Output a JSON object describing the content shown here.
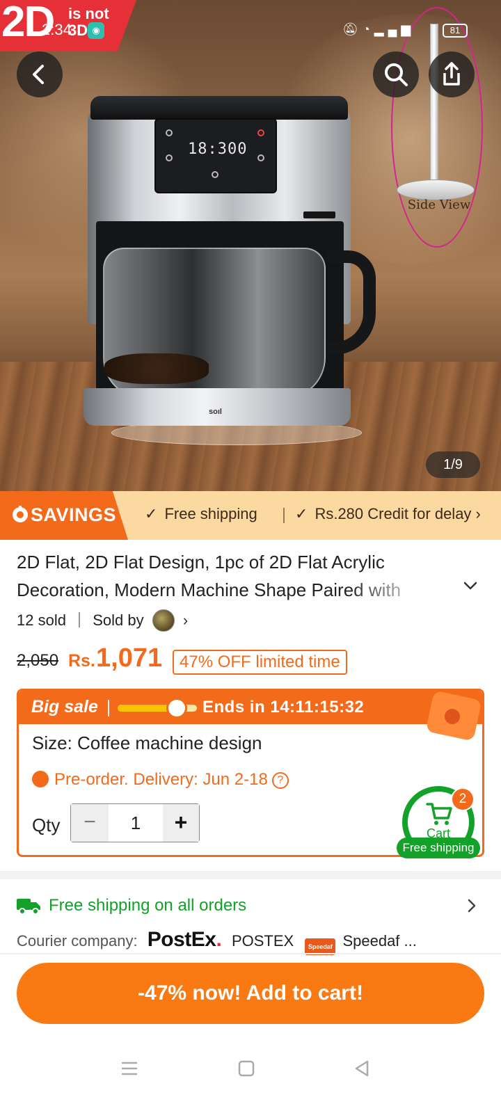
{
  "status_bar": {
    "time": "2:34",
    "battery": "81"
  },
  "hero": {
    "badge_big": "2D",
    "badge_small_1": "is not",
    "badge_small_2": "3D",
    "panel_time": "18:300",
    "base_brand": "soıl",
    "side_view_caption": "Side View",
    "image_counter": "1/9"
  },
  "savings": {
    "label": "SAVINGS",
    "item1": "Free shipping",
    "item2": "Rs.280 Credit for delay"
  },
  "product": {
    "title": "2D Flat, 2D Flat Design, 1pc of 2D Flat Acrylic Decoration, Modern Machine Shape Paired with",
    "sold": "12 sold",
    "sold_by": "Sold by",
    "old_price": "2,050",
    "currency": "Rs.",
    "price": "1,071",
    "discount": "47% OFF limited time"
  },
  "sale": {
    "label": "Big sale",
    "ends": "Ends in 14:11:15:32",
    "progress": 0.78,
    "size": "Size: Coffee machine design",
    "preorder": "Pre-order. Delivery: Jun 2-18",
    "help": "?",
    "qty_label": "Qty",
    "qty_value": "1",
    "minus": "−",
    "plus": "+"
  },
  "cart": {
    "label": "Cart",
    "count": "2",
    "shipping": "Free shipping"
  },
  "shipping": {
    "headline": "Free shipping on all orders",
    "courier_label": "Courier company:",
    "postex_logo": "PostEx",
    "postex_name": "POSTEX",
    "speedaf_logo": "Speedaf",
    "speedaf_name": "Speedaf ..."
  },
  "cta": {
    "label": "-47% now! Add to cart!"
  },
  "colors": {
    "accent": "#f36a1a",
    "green": "#13a12a",
    "savings_bg": "#fcd9a0"
  }
}
